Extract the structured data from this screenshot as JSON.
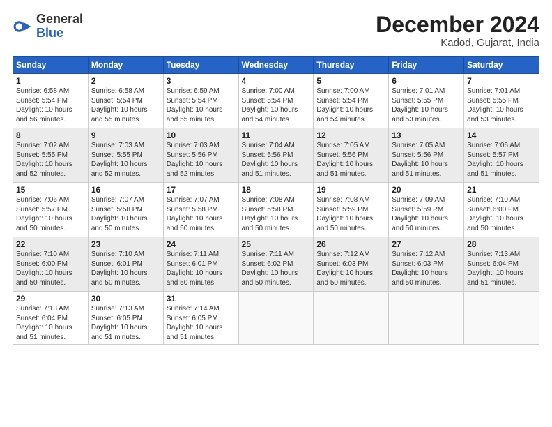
{
  "header": {
    "logo_general": "General",
    "logo_blue": "Blue",
    "month_title": "December 2024",
    "location": "Kadod, Gujarat, India"
  },
  "days_of_week": [
    "Sunday",
    "Monday",
    "Tuesday",
    "Wednesday",
    "Thursday",
    "Friday",
    "Saturday"
  ],
  "weeks": [
    [
      {
        "day": "1",
        "info": "Sunrise: 6:58 AM\nSunset: 5:54 PM\nDaylight: 10 hours\nand 56 minutes."
      },
      {
        "day": "2",
        "info": "Sunrise: 6:58 AM\nSunset: 5:54 PM\nDaylight: 10 hours\nand 55 minutes."
      },
      {
        "day": "3",
        "info": "Sunrise: 6:59 AM\nSunset: 5:54 PM\nDaylight: 10 hours\nand 55 minutes."
      },
      {
        "day": "4",
        "info": "Sunrise: 7:00 AM\nSunset: 5:54 PM\nDaylight: 10 hours\nand 54 minutes."
      },
      {
        "day": "5",
        "info": "Sunrise: 7:00 AM\nSunset: 5:54 PM\nDaylight: 10 hours\nand 54 minutes."
      },
      {
        "day": "6",
        "info": "Sunrise: 7:01 AM\nSunset: 5:55 PM\nDaylight: 10 hours\nand 53 minutes."
      },
      {
        "day": "7",
        "info": "Sunrise: 7:01 AM\nSunset: 5:55 PM\nDaylight: 10 hours\nand 53 minutes."
      }
    ],
    [
      {
        "day": "8",
        "info": "Sunrise: 7:02 AM\nSunset: 5:55 PM\nDaylight: 10 hours\nand 52 minutes."
      },
      {
        "day": "9",
        "info": "Sunrise: 7:03 AM\nSunset: 5:55 PM\nDaylight: 10 hours\nand 52 minutes."
      },
      {
        "day": "10",
        "info": "Sunrise: 7:03 AM\nSunset: 5:56 PM\nDaylight: 10 hours\nand 52 minutes."
      },
      {
        "day": "11",
        "info": "Sunrise: 7:04 AM\nSunset: 5:56 PM\nDaylight: 10 hours\nand 51 minutes."
      },
      {
        "day": "12",
        "info": "Sunrise: 7:05 AM\nSunset: 5:56 PM\nDaylight: 10 hours\nand 51 minutes."
      },
      {
        "day": "13",
        "info": "Sunrise: 7:05 AM\nSunset: 5:56 PM\nDaylight: 10 hours\nand 51 minutes."
      },
      {
        "day": "14",
        "info": "Sunrise: 7:06 AM\nSunset: 5:57 PM\nDaylight: 10 hours\nand 51 minutes."
      }
    ],
    [
      {
        "day": "15",
        "info": "Sunrise: 7:06 AM\nSunset: 5:57 PM\nDaylight: 10 hours\nand 50 minutes."
      },
      {
        "day": "16",
        "info": "Sunrise: 7:07 AM\nSunset: 5:58 PM\nDaylight: 10 hours\nand 50 minutes."
      },
      {
        "day": "17",
        "info": "Sunrise: 7:07 AM\nSunset: 5:58 PM\nDaylight: 10 hours\nand 50 minutes."
      },
      {
        "day": "18",
        "info": "Sunrise: 7:08 AM\nSunset: 5:58 PM\nDaylight: 10 hours\nand 50 minutes."
      },
      {
        "day": "19",
        "info": "Sunrise: 7:08 AM\nSunset: 5:59 PM\nDaylight: 10 hours\nand 50 minutes."
      },
      {
        "day": "20",
        "info": "Sunrise: 7:09 AM\nSunset: 5:59 PM\nDaylight: 10 hours\nand 50 minutes."
      },
      {
        "day": "21",
        "info": "Sunrise: 7:10 AM\nSunset: 6:00 PM\nDaylight: 10 hours\nand 50 minutes."
      }
    ],
    [
      {
        "day": "22",
        "info": "Sunrise: 7:10 AM\nSunset: 6:00 PM\nDaylight: 10 hours\nand 50 minutes."
      },
      {
        "day": "23",
        "info": "Sunrise: 7:10 AM\nSunset: 6:01 PM\nDaylight: 10 hours\nand 50 minutes."
      },
      {
        "day": "24",
        "info": "Sunrise: 7:11 AM\nSunset: 6:01 PM\nDaylight: 10 hours\nand 50 minutes."
      },
      {
        "day": "25",
        "info": "Sunrise: 7:11 AM\nSunset: 6:02 PM\nDaylight: 10 hours\nand 50 minutes."
      },
      {
        "day": "26",
        "info": "Sunrise: 7:12 AM\nSunset: 6:03 PM\nDaylight: 10 hours\nand 50 minutes."
      },
      {
        "day": "27",
        "info": "Sunrise: 7:12 AM\nSunset: 6:03 PM\nDaylight: 10 hours\nand 50 minutes."
      },
      {
        "day": "28",
        "info": "Sunrise: 7:13 AM\nSunset: 6:04 PM\nDaylight: 10 hours\nand 51 minutes."
      }
    ],
    [
      {
        "day": "29",
        "info": "Sunrise: 7:13 AM\nSunset: 6:04 PM\nDaylight: 10 hours\nand 51 minutes."
      },
      {
        "day": "30",
        "info": "Sunrise: 7:13 AM\nSunset: 6:05 PM\nDaylight: 10 hours\nand 51 minutes."
      },
      {
        "day": "31",
        "info": "Sunrise: 7:14 AM\nSunset: 6:05 PM\nDaylight: 10 hours\nand 51 minutes."
      },
      {
        "day": "",
        "info": ""
      },
      {
        "day": "",
        "info": ""
      },
      {
        "day": "",
        "info": ""
      },
      {
        "day": "",
        "info": ""
      }
    ]
  ]
}
